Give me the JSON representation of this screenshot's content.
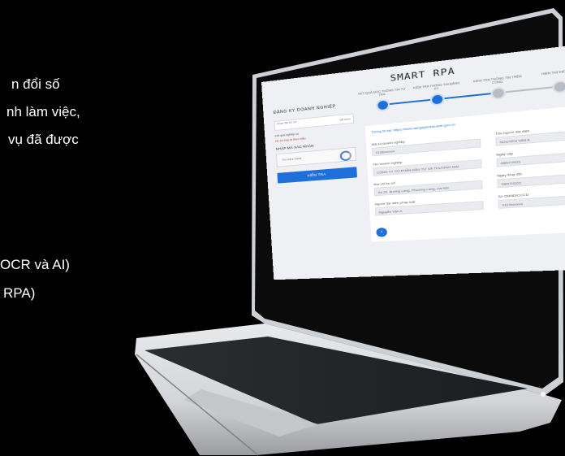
{
  "background_text": {
    "line1": "n đổi số",
    "line2": "nh làm việc,",
    "line3": "vụ đã được",
    "line4": "OCR và AI)",
    "line5": "RPA)"
  },
  "app": {
    "title": "SMART RPA",
    "steps": [
      "KẾT QUẢ ĐỌC THÔNG TIN TỪ TRA",
      "KIỂM TRA THÔNG TIN ĐĂNG KÝ",
      "KIỂM TRA THÔNG TIN TRÊN CỔNG",
      "HIỂN THỊ KIỂM TRA"
    ],
    "left_panel": {
      "title": "ĐĂNG KÝ DOANH NGHIỆP",
      "field1_label": "Chọn file hồ sơ",
      "field1_value": "Đã chọn",
      "note1": "Kết quả nghiệp vụ",
      "note2": "Hồ sơ hợp lệ theo mẫu",
      "captcha_title": "NHẬP MÃ XÁC NHẬN",
      "captcha_text": "I'm not a robot",
      "submit_label": "KIỂM TRA"
    },
    "form": {
      "link_label": "Thông tin tại: https://www.dangkykinhdoanh.gov.vn",
      "fields": [
        {
          "label": "Mã số doanh nghiệp",
          "value": "0108xxxxxx"
        },
        {
          "label": "Tên người đại diện",
          "value": "NGUYEN VAN A"
        },
        {
          "label": "Tên doanh nghiệp",
          "value": "CÔNG TY CỔ PHẦN ĐẦU TƯ VÀ THƯƠNG MẠI"
        },
        {
          "label": "Ngày cấp",
          "value": "08/07/2021"
        },
        {
          "label": "Địa chỉ trụ sở",
          "value": "Số 20, đường Láng, Phường Láng, Hà Nội"
        },
        {
          "label": "Ngày thay đổi",
          "value": "08/07/2021"
        },
        {
          "label": "Người đại diện pháp luật",
          "value": "Nguyễn Văn A"
        },
        {
          "label": "Số CMND/CCCD",
          "value": "0119xxxxxx"
        }
      ]
    }
  },
  "colors": {
    "accent": "#1e6fd9",
    "page_bg": "#000000",
    "text": "#ffffff"
  }
}
